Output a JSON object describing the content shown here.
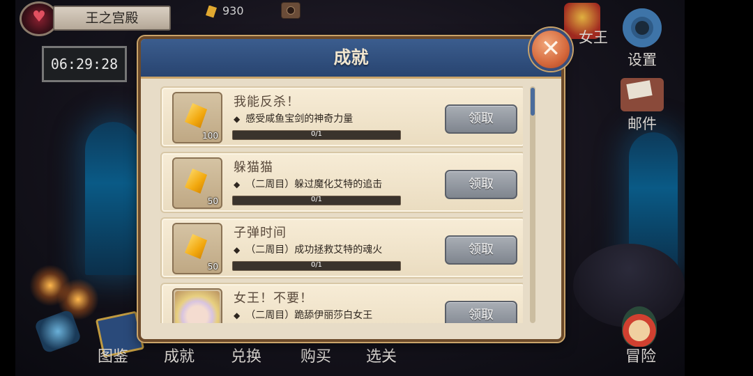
{
  "hud": {
    "location": "王之宫殿",
    "timer": "06:29:28",
    "gems": "930"
  },
  "side_nav": {
    "queen_partial": "女王",
    "settings": "设置",
    "mail": "邮件"
  },
  "bottom_nav": {
    "codex": "图鉴",
    "achievements": "成就",
    "exchange": "兑换",
    "shop": "购买",
    "stage_select": "选关",
    "adventure": "冒险"
  },
  "dialog": {
    "title": "成就",
    "bullet": "◆",
    "achievements": [
      {
        "title": "我能反杀！",
        "desc": "感受咸鱼宝剑的神奇力量",
        "progress": "0/1",
        "reward_amount": "100",
        "reward_icon": "gem-icon",
        "claim_label": "领取"
      },
      {
        "title": "躲猫猫",
        "desc": "（二周目）躲过魔化艾特的追击",
        "progress": "0/1",
        "reward_amount": "50",
        "reward_icon": "gem-icon",
        "claim_label": "领取"
      },
      {
        "title": "子弹时间",
        "desc": "（二周目）成功拯救艾特的魂火",
        "progress": "0/1",
        "reward_amount": "50",
        "reward_icon": "gem-icon",
        "claim_label": "领取"
      },
      {
        "title": "女王！不要！",
        "desc": "（二周目）跪舔伊丽莎白女王",
        "reward_icon": "portrait-icon",
        "claim_label": "领取"
      }
    ]
  },
  "colors": {
    "dialog_header": "#2f4f80",
    "parchment": "#e7dcc7",
    "claim_button": "#8f959d",
    "close_button": "#e07a48"
  }
}
